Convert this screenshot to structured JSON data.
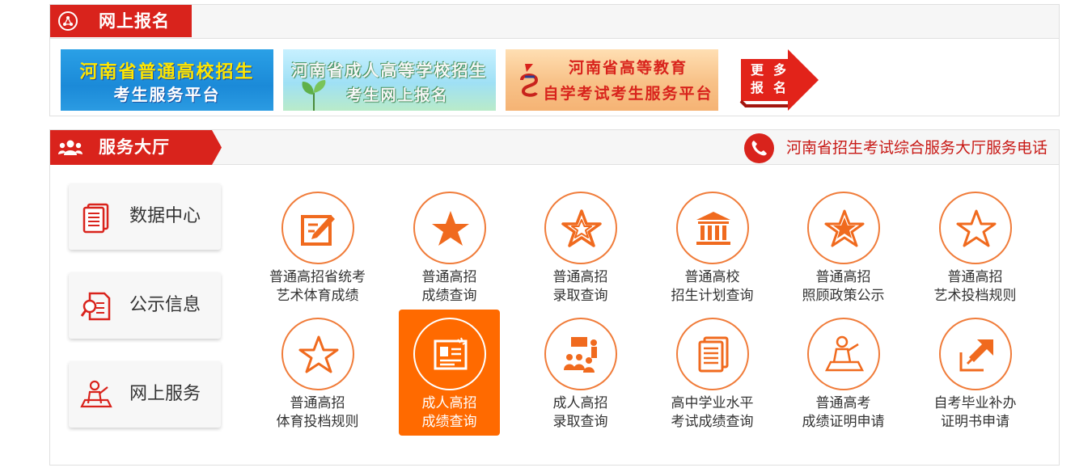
{
  "online_signup": {
    "title": "网上报名",
    "banners": [
      {
        "line1": "河南省普通高校招生",
        "line2": "考生服务平台"
      },
      {
        "line1": "河南省成人高等学校招生",
        "line2": "考生网上报名"
      },
      {
        "line1": "河南省高等教育",
        "line2": "自学考试考生服务平台"
      }
    ],
    "more": {
      "line1_a": "更",
      "line1_b": "多",
      "line2_a": "报",
      "line2_b": "名"
    }
  },
  "service_hall": {
    "title": "服务大厅",
    "phone_label": "河南省招生考试综合服务大厅服务电话",
    "side_buttons": [
      {
        "label": "数据中心",
        "icon": "document-icon"
      },
      {
        "label": "公示信息",
        "icon": "inspect-document-icon"
      },
      {
        "label": "网上服务",
        "icon": "presenter-icon"
      }
    ],
    "services": [
      {
        "line1": "普通高招省统考",
        "line2": "艺术体育成绩",
        "icon": "edit-icon"
      },
      {
        "line1": "普通高招",
        "line2": "成绩查询",
        "icon": "star-solid-icon"
      },
      {
        "line1": "普通高招",
        "line2": "录取查询",
        "icon": "star-double-icon"
      },
      {
        "line1": "普通高校",
        "line2": "招生计划查询",
        "icon": "building-icon"
      },
      {
        "line1": "普通高招",
        "line2": "照顾政策公示",
        "icon": "star-filled-outline-icon"
      },
      {
        "line1": "普通高招",
        "line2": "艺术投档规则",
        "icon": "star-outline-icon"
      },
      {
        "line1": "普通高招",
        "line2": "体育投档规则",
        "icon": "star-outline-icon"
      },
      {
        "line1": "成人高招",
        "line2": "成绩查询",
        "icon": "certificate-icon",
        "active": true
      },
      {
        "line1": "成人高招",
        "line2": "录取查询",
        "icon": "classroom-icon"
      },
      {
        "line1": "高中学业水平",
        "line2": "考试成绩查询",
        "icon": "document-stack-icon"
      },
      {
        "line1": "普通高考",
        "line2": "成绩证明申请",
        "icon": "presenter-icon"
      },
      {
        "line1": "自考毕业补办",
        "line2": "证明书申请",
        "icon": "share-arrow-icon"
      }
    ]
  },
  "colors": {
    "brand_red": "#d9231c",
    "accent_orange": "#ff6a00",
    "ring_orange": "#f07c3a"
  }
}
